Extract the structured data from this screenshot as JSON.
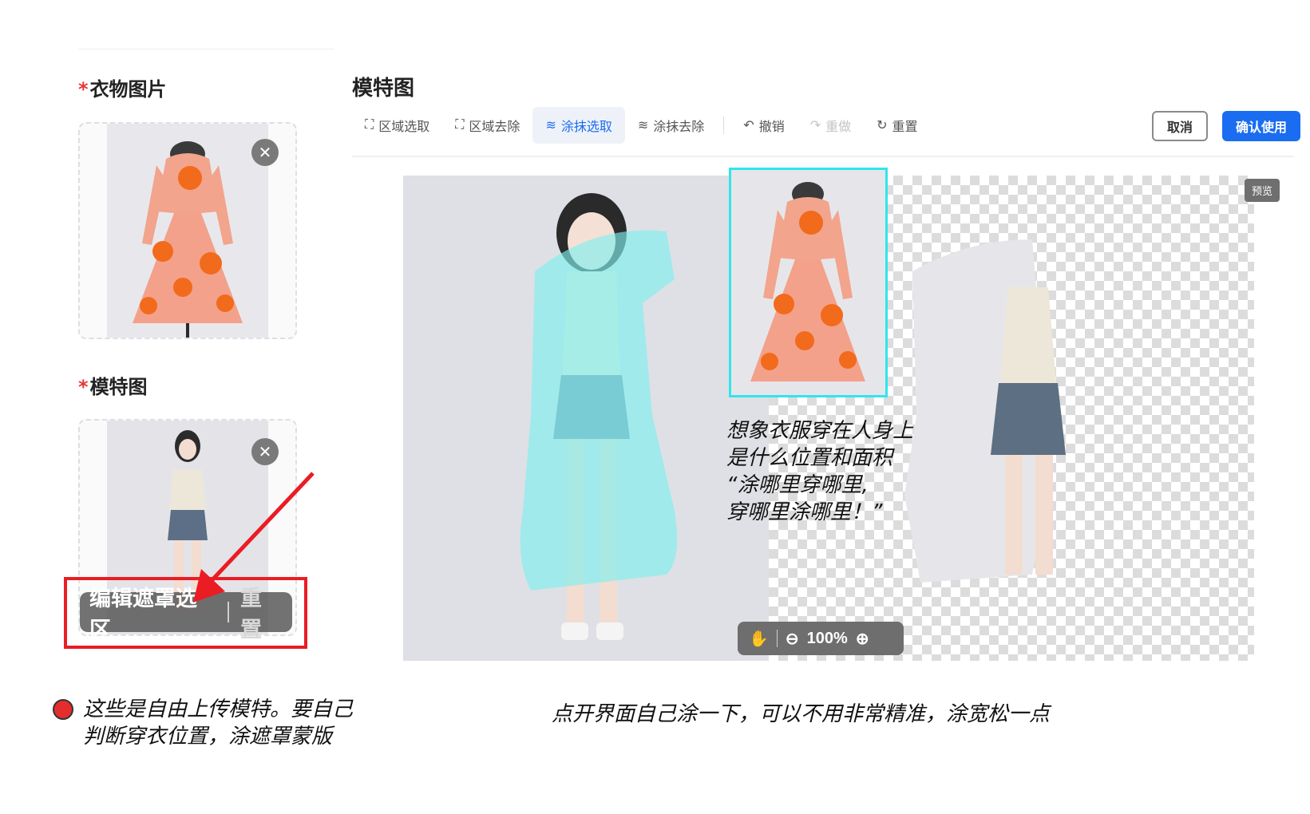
{
  "left_panel": {
    "required_mark": "*",
    "clothes_title": "衣物图片",
    "model_title": "模特图",
    "close_symbol": "✕",
    "mask_edit_label": "编辑遮罩选区",
    "mask_reset_label": "重置"
  },
  "editor": {
    "title": "模特图",
    "tools": [
      {
        "label": "区域选取",
        "icon": "area-select-icon",
        "glyph": "⛶",
        "state": "normal"
      },
      {
        "label": "区域去除",
        "icon": "area-remove-icon",
        "glyph": "⛶",
        "state": "normal"
      },
      {
        "label": "涂抹选取",
        "icon": "brush-select-icon",
        "glyph": "≋",
        "state": "active"
      },
      {
        "label": "涂抹去除",
        "icon": "brush-remove-icon",
        "glyph": "≋",
        "state": "normal"
      },
      {
        "label": "撤销",
        "icon": "undo-icon",
        "glyph": "↶",
        "state": "normal"
      },
      {
        "label": "重做",
        "icon": "redo-icon",
        "glyph": "↷",
        "state": "disabled"
      },
      {
        "label": "重置",
        "icon": "reset-icon",
        "glyph": "↻",
        "state": "normal"
      }
    ],
    "cancel_label": "取消",
    "confirm_label": "确认使用",
    "preview_badge": "预览",
    "zoom_level": "100%",
    "colors": {
      "accent": "#1a6df0",
      "mask": "#7ff0ee",
      "reference_border": "#2ee6ee",
      "annotation_red": "#ea1c24"
    }
  },
  "annotations": {
    "clothes_note": "想象衣服穿在人身上\n是什么位置和面积\n“涂哪里穿哪里,\n穿哪里涂哪里！”",
    "left_note": "这些是自由上传模特。要自己\n判断穿衣位置，涂遮罩蒙版",
    "bottom_note": "点开界面自己涂一下，可以不用非常精准，涂宽松一点"
  }
}
